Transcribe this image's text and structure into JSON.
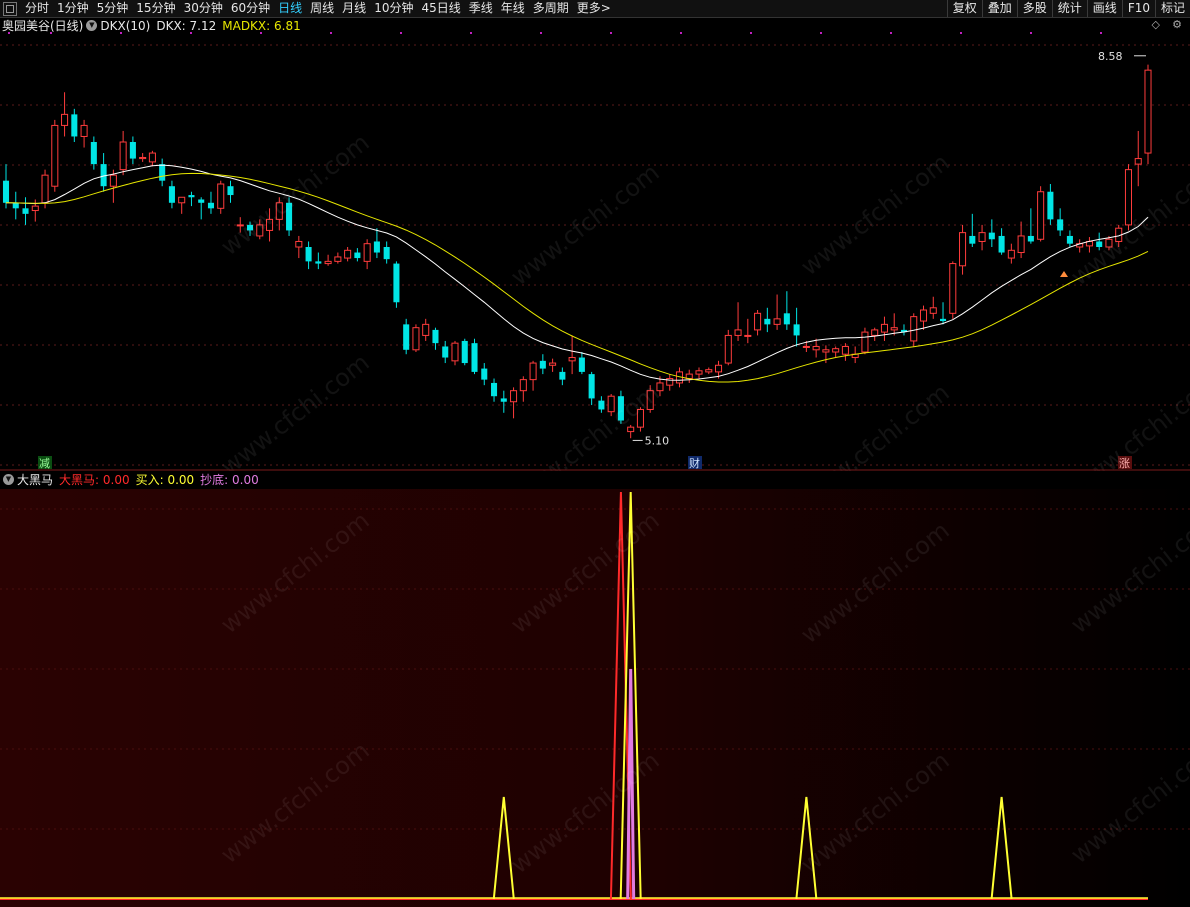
{
  "toolbar": {
    "periods": [
      "分时",
      "1分钟",
      "5分钟",
      "15分钟",
      "30分钟",
      "60分钟",
      "日线",
      "周线",
      "月线",
      "10分钟",
      "45日线",
      "季线",
      "年线",
      "多周期",
      "更多>"
    ],
    "active_period": "日线",
    "right_buttons": [
      "复权",
      "叠加",
      "多股",
      "统计",
      "画线",
      "F10",
      "标记"
    ]
  },
  "main_pane": {
    "stock_title": "奥园美谷(日线)",
    "indicator_name": "DKX(10)",
    "dkx_label": "DKX: 7.12",
    "madkx_label": "MADKX: 6.81",
    "high_label": "8.58",
    "low_label": "5.10",
    "badge_left": "减",
    "badge_mid": "财",
    "badge_right": "涨",
    "colors": {
      "up": "#ff3c3c",
      "down": "#00e5e5",
      "dkx": "#ffffff",
      "madkx": "#e6e600"
    }
  },
  "indicator_pane": {
    "name": "大黑马",
    "series": [
      {
        "label": "大黑马: 0.00",
        "color": "#ff2a2a"
      },
      {
        "label": "买入: 0.00",
        "color": "#ffff33"
      },
      {
        "label": "抄底: 0.00",
        "color": "#e07be0"
      }
    ]
  },
  "watermark": "www.cfchi.com",
  "chart_data": {
    "type": "candlestick",
    "high": 8.58,
    "low": 5.1,
    "dkx_last": 7.12,
    "madkx_last": 6.81,
    "ohlc": [
      [
        7.45,
        7.6,
        7.2,
        7.25
      ],
      [
        7.25,
        7.35,
        7.1,
        7.2
      ],
      [
        7.2,
        7.3,
        7.05,
        7.15
      ],
      [
        7.18,
        7.28,
        7.08,
        7.22
      ],
      [
        7.25,
        7.55,
        7.2,
        7.5
      ],
      [
        7.4,
        8.0,
        7.35,
        7.95
      ],
      [
        7.95,
        8.25,
        7.85,
        8.05
      ],
      [
        8.05,
        8.1,
        7.8,
        7.85
      ],
      [
        7.85,
        8.0,
        7.75,
        7.95
      ],
      [
        7.8,
        7.85,
        7.55,
        7.6
      ],
      [
        7.6,
        7.7,
        7.35,
        7.4
      ],
      [
        7.4,
        7.55,
        7.25,
        7.5
      ],
      [
        7.55,
        7.9,
        7.5,
        7.8
      ],
      [
        7.8,
        7.85,
        7.6,
        7.65
      ],
      [
        7.65,
        7.7,
        7.62,
        7.66
      ],
      [
        7.62,
        7.72,
        7.58,
        7.7
      ],
      [
        7.6,
        7.65,
        7.4,
        7.45
      ],
      [
        7.4,
        7.45,
        7.2,
        7.25
      ],
      [
        7.25,
        7.3,
        7.15,
        7.3
      ],
      [
        7.32,
        7.35,
        7.22,
        7.3
      ],
      [
        7.28,
        7.3,
        7.1,
        7.25
      ],
      [
        7.25,
        7.35,
        7.15,
        7.2
      ],
      [
        7.2,
        7.45,
        7.15,
        7.42
      ],
      [
        7.4,
        7.45,
        7.25,
        7.32
      ],
      [
        7.05,
        7.12,
        6.98,
        7.05
      ],
      [
        7.05,
        7.08,
        6.95,
        7.0
      ],
      [
        6.95,
        7.1,
        6.92,
        7.05
      ],
      [
        7.0,
        7.2,
        6.9,
        7.1
      ],
      [
        7.1,
        7.3,
        7.0,
        7.25
      ],
      [
        7.25,
        7.3,
        6.95,
        7.0
      ],
      [
        6.85,
        6.95,
        6.75,
        6.9
      ],
      [
        6.85,
        6.9,
        6.65,
        6.72
      ],
      [
        6.72,
        6.8,
        6.65,
        6.7
      ],
      [
        6.7,
        6.78,
        6.68,
        6.72
      ],
      [
        6.72,
        6.8,
        6.7,
        6.76
      ],
      [
        6.75,
        6.85,
        6.72,
        6.82
      ],
      [
        6.8,
        6.84,
        6.72,
        6.75
      ],
      [
        6.72,
        6.92,
        6.65,
        6.88
      ],
      [
        6.9,
        7.02,
        6.75,
        6.8
      ],
      [
        6.85,
        6.9,
        6.7,
        6.74
      ],
      [
        6.7,
        6.72,
        6.3,
        6.35
      ],
      [
        6.15,
        6.2,
        5.88,
        5.92
      ],
      [
        5.92,
        6.15,
        5.9,
        6.12
      ],
      [
        6.05,
        6.2,
        6.0,
        6.15
      ],
      [
        6.1,
        6.12,
        5.92,
        5.98
      ],
      [
        5.95,
        6.0,
        5.8,
        5.85
      ],
      [
        5.82,
        6.0,
        5.78,
        5.98
      ],
      [
        6.0,
        6.02,
        5.78,
        5.8
      ],
      [
        5.98,
        6.02,
        5.7,
        5.72
      ],
      [
        5.75,
        5.8,
        5.6,
        5.65
      ],
      [
        5.62,
        5.66,
        5.45,
        5.5
      ],
      [
        5.48,
        5.55,
        5.35,
        5.45
      ],
      [
        5.45,
        5.58,
        5.3,
        5.55
      ],
      [
        5.55,
        5.68,
        5.45,
        5.65
      ],
      [
        5.65,
        5.82,
        5.55,
        5.8
      ],
      [
        5.82,
        5.88,
        5.7,
        5.75
      ],
      [
        5.78,
        5.84,
        5.72,
        5.8
      ],
      [
        5.72,
        5.76,
        5.6,
        5.65
      ],
      [
        5.82,
        6.05,
        5.7,
        5.85
      ],
      [
        5.85,
        5.9,
        5.7,
        5.72
      ],
      [
        5.7,
        5.72,
        5.42,
        5.48
      ],
      [
        5.46,
        5.5,
        5.35,
        5.38
      ],
      [
        5.36,
        5.52,
        5.32,
        5.5
      ],
      [
        5.5,
        5.55,
        5.25,
        5.28
      ],
      [
        5.18,
        5.24,
        5.12,
        5.22
      ],
      [
        5.22,
        5.4,
        5.18,
        5.38
      ],
      [
        5.38,
        5.6,
        5.35,
        5.55
      ],
      [
        5.55,
        5.68,
        5.5,
        5.62
      ],
      [
        5.6,
        5.7,
        5.55,
        5.66
      ],
      [
        5.62,
        5.76,
        5.58,
        5.72
      ],
      [
        5.66,
        5.74,
        5.62,
        5.7
      ],
      [
        5.7,
        5.76,
        5.66,
        5.73
      ],
      [
        5.72,
        5.76,
        5.7,
        5.74
      ],
      [
        5.72,
        5.82,
        5.66,
        5.78
      ],
      [
        5.8,
        6.1,
        5.78,
        6.05
      ],
      [
        6.05,
        6.35,
        6.0,
        6.1
      ],
      [
        6.05,
        6.2,
        5.98,
        6.05
      ],
      [
        6.1,
        6.28,
        6.05,
        6.25
      ],
      [
        6.2,
        6.3,
        6.08,
        6.15
      ],
      [
        6.15,
        6.42,
        6.1,
        6.2
      ],
      [
        6.25,
        6.45,
        6.1,
        6.15
      ],
      [
        6.15,
        6.3,
        5.95,
        6.05
      ],
      [
        5.95,
        6.0,
        5.9,
        5.95
      ],
      [
        5.92,
        6.02,
        5.85,
        5.95
      ],
      [
        5.9,
        5.96,
        5.8,
        5.92
      ],
      [
        5.9,
        5.95,
        5.85,
        5.93
      ],
      [
        5.88,
        5.98,
        5.82,
        5.95
      ],
      [
        5.85,
        5.95,
        5.8,
        5.88
      ],
      [
        5.9,
        6.12,
        5.88,
        6.08
      ],
      [
        6.05,
        6.12,
        6.0,
        6.1
      ],
      [
        6.08,
        6.22,
        6.0,
        6.15
      ],
      [
        6.1,
        6.25,
        6.05,
        6.12
      ],
      [
        6.1,
        6.15,
        6.05,
        6.08
      ],
      [
        6.0,
        6.25,
        5.95,
        6.22
      ],
      [
        6.18,
        6.32,
        6.1,
        6.28
      ],
      [
        6.25,
        6.4,
        6.2,
        6.3
      ],
      [
        6.2,
        6.35,
        6.15,
        6.18
      ],
      [
        6.25,
        6.72,
        6.2,
        6.7
      ],
      [
        6.68,
        7.05,
        6.6,
        6.98
      ],
      [
        6.95,
        7.15,
        6.85,
        6.88
      ],
      [
        6.9,
        7.05,
        6.82,
        6.98
      ],
      [
        6.98,
        7.1,
        6.85,
        6.92
      ],
      [
        6.95,
        7.02,
        6.78,
        6.8
      ],
      [
        6.75,
        6.88,
        6.7,
        6.82
      ],
      [
        6.8,
        7.08,
        6.75,
        6.95
      ],
      [
        6.95,
        7.2,
        6.88,
        6.9
      ],
      [
        6.92,
        7.4,
        6.9,
        7.35
      ],
      [
        7.35,
        7.42,
        7.05,
        7.1
      ],
      [
        7.1,
        7.2,
        6.95,
        7.0
      ],
      [
        6.95,
        7.0,
        6.85,
        6.88
      ],
      [
        6.85,
        6.92,
        6.8,
        6.88
      ],
      [
        6.86,
        6.94,
        6.8,
        6.9
      ],
      [
        6.9,
        6.98,
        6.82,
        6.85
      ],
      [
        6.85,
        6.95,
        6.82,
        6.92
      ],
      [
        6.9,
        7.05,
        6.85,
        7.02
      ],
      [
        7.05,
        7.6,
        7.0,
        7.55
      ],
      [
        7.6,
        7.9,
        7.4,
        7.65
      ],
      [
        7.7,
        8.5,
        7.6,
        8.45
      ]
    ],
    "signals": {
      "dahema_spike_index": 63,
      "buy_spike_indices": [
        51,
        64,
        82,
        102
      ],
      "chaodi_spike_index": 64
    }
  }
}
